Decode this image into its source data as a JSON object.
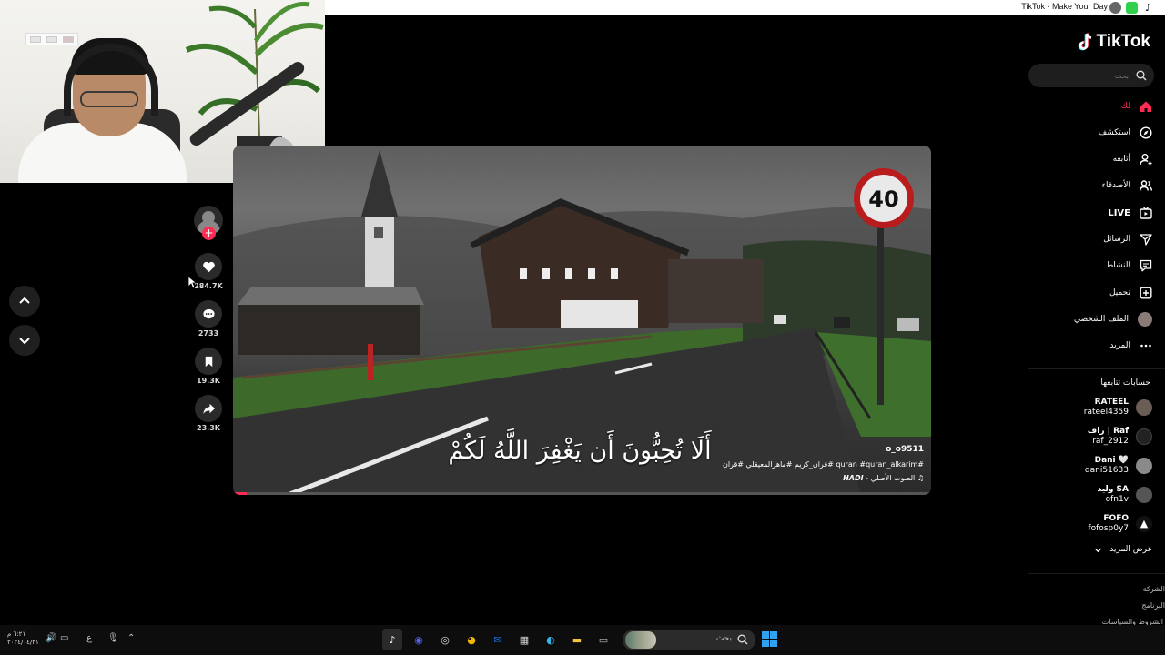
{
  "window": {
    "title": "TikTok - Make Your Day"
  },
  "video": {
    "overlay_text": "أَلَا تُحِبُّونَ أَن يَغْفِرَ اللَّهُ لَكُمْ",
    "author": "o_o9511",
    "caption": "#quran #quran_alkarim #قران_كريم #ماهرالمعيقلي #قران",
    "sound_label": "الصوت الأصلي -",
    "sound_author": "HADI",
    "sign_number": "40",
    "progress": 0.02
  },
  "actions": {
    "likes": "284.7K",
    "comments": "2733",
    "saves": "19.3K",
    "shares": "23.3K"
  },
  "sidebar": {
    "logo": "TikTok",
    "search_placeholder": "بحث",
    "nav": [
      {
        "label": "لك",
        "icon": "home-icon",
        "active": true
      },
      {
        "label": "استكشف",
        "icon": "compass-icon"
      },
      {
        "label": "أتابعه",
        "icon": "user-follow-icon"
      },
      {
        "label": "الأصدقاء",
        "icon": "friends-icon"
      },
      {
        "label": "LIVE",
        "icon": "live-icon"
      },
      {
        "label": "الرسائل",
        "icon": "send-icon"
      },
      {
        "label": "النشاط",
        "icon": "activity-icon"
      },
      {
        "label": "تحميل",
        "icon": "upload-icon"
      },
      {
        "label": "الملف الشخصي",
        "icon": "profile-avatar"
      },
      {
        "label": "المزيد",
        "icon": "more-icon"
      }
    ],
    "following_title": "حسابات تتابعها",
    "following": [
      {
        "name": "RATEEL",
        "handle": "rateel4359"
      },
      {
        "name": "راف | Raf",
        "handle": "raf_2912"
      },
      {
        "name": "Dani 🤍",
        "handle": "dani51633"
      },
      {
        "name": "وليد SA",
        "handle": "ofn1v"
      },
      {
        "name": "FOFO",
        "handle": "fofosp0y7"
      }
    ],
    "show_more": "عرض المزيد",
    "footer": [
      "الشركة",
      "البرنامج",
      "الشروط والسياسات"
    ]
  },
  "taskbar": {
    "time": "٦:٢١ م",
    "date": "٢٠٢٤/٠٤/٢١",
    "lang": "ع",
    "search_label": "بحث"
  }
}
